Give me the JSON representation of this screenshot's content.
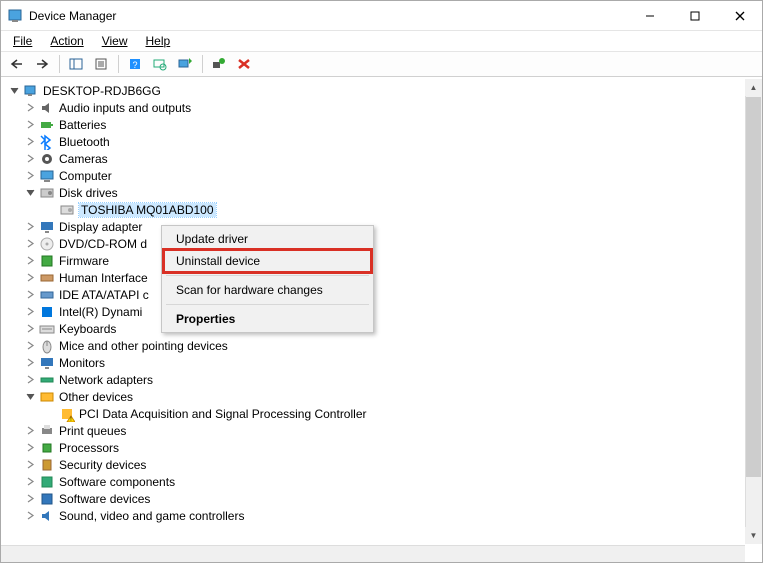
{
  "window": {
    "title": "Device Manager"
  },
  "menu": {
    "file": "File",
    "action": "Action",
    "view": "View",
    "help": "Help"
  },
  "tree": {
    "root": "DESKTOP-RDJB6GG",
    "items": [
      {
        "label": "Audio inputs and outputs",
        "exp": ">",
        "ic": "audio"
      },
      {
        "label": "Batteries",
        "exp": ">",
        "ic": "batt"
      },
      {
        "label": "Bluetooth",
        "exp": ">",
        "ic": "bt"
      },
      {
        "label": "Cameras",
        "exp": ">",
        "ic": "cam"
      },
      {
        "label": "Computer",
        "exp": ">",
        "ic": "comp"
      },
      {
        "label": "Disk drives",
        "exp": "v",
        "ic": "disk",
        "children": [
          {
            "label": "TOSHIBA MQ01ABD100",
            "ic": "hdd",
            "selected": true
          }
        ]
      },
      {
        "label": "Display adapter",
        "exp": ">",
        "ic": "disp",
        "cut": true
      },
      {
        "label": "DVD/CD-ROM d",
        "exp": ">",
        "ic": "dvd",
        "cut": true
      },
      {
        "label": "Firmware",
        "exp": ">",
        "ic": "fw",
        "cut": true
      },
      {
        "label": "Human Interface",
        "exp": ">",
        "ic": "hid",
        "cut": true
      },
      {
        "label": "IDE ATA/ATAPI c",
        "exp": ">",
        "ic": "ide",
        "cut": true
      },
      {
        "label": "Intel(R) Dynami",
        "exp": ">",
        "ic": "intel",
        "cut": true
      },
      {
        "label": "Keyboards",
        "exp": ">",
        "ic": "kb"
      },
      {
        "label": "Mice and other pointing devices",
        "exp": ">",
        "ic": "mouse"
      },
      {
        "label": "Monitors",
        "exp": ">",
        "ic": "mon"
      },
      {
        "label": "Network adapters",
        "exp": ">",
        "ic": "net"
      },
      {
        "label": "Other devices",
        "exp": "v",
        "ic": "other",
        "children": [
          {
            "label": "PCI Data Acquisition and Signal Processing Controller",
            "ic": "warn"
          }
        ]
      },
      {
        "label": "Print queues",
        "exp": ">",
        "ic": "print"
      },
      {
        "label": "Processors",
        "exp": ">",
        "ic": "cpu"
      },
      {
        "label": "Security devices",
        "exp": ">",
        "ic": "sec"
      },
      {
        "label": "Software components",
        "exp": ">",
        "ic": "swc"
      },
      {
        "label": "Software devices",
        "exp": ">",
        "ic": "swd"
      },
      {
        "label": "Sound, video and game controllers",
        "exp": ">",
        "ic": "snd"
      }
    ]
  },
  "context_menu": {
    "items": [
      "Update driver",
      "Uninstall device",
      "Scan for hardware changes",
      "Properties"
    ],
    "highlighted_index": 1,
    "bold_index": 3
  }
}
